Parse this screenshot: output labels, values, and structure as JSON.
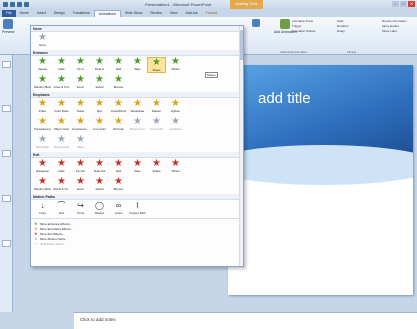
{
  "window": {
    "title": "Presentation1 - Microsoft PowerPoint",
    "context_tab": "Drawing Tools"
  },
  "tabs": [
    "File",
    "Home",
    "Insert",
    "Design",
    "Transitions",
    "Animations",
    "Slide Show",
    "Review",
    "View",
    "Add-Ins",
    "Format"
  ],
  "ribbon": {
    "preview": "Preview",
    "animation_pane": "Animation Pane",
    "trigger": "Trigger",
    "animation_painter": "Animation Painter",
    "add_animation": "Add Animation",
    "advanced_animation": "Advanced Animation",
    "start": "Start:",
    "duration": "Duration:",
    "delay": "Delay:",
    "timing": "Timing",
    "reorder": "Reorder Animation",
    "move_earlier": "Move Earlier",
    "move_later": "Move Later"
  },
  "gallery": {
    "none_header": "None",
    "none_items": [
      {
        "label": "None",
        "color": "s-gray"
      }
    ],
    "entrance_header": "Entrance",
    "entrance_row1": [
      {
        "label": "Appear",
        "color": "s-green"
      },
      {
        "label": "Fade",
        "color": "s-green"
      },
      {
        "label": "Fly In",
        "color": "s-green"
      },
      {
        "label": "Float In",
        "color": "s-green"
      },
      {
        "label": "Split",
        "color": "s-green"
      },
      {
        "label": "Wipe",
        "color": "s-green"
      },
      {
        "label": "Shape",
        "color": "s-green",
        "highlight": true
      },
      {
        "label": "Wheel",
        "color": "s-green"
      }
    ],
    "entrance_row2": [
      {
        "label": "Random Bars",
        "color": "s-green"
      },
      {
        "label": "Grow & Turn",
        "color": "s-green"
      },
      {
        "label": "Zoom",
        "color": "s-green"
      },
      {
        "label": "Swivel",
        "color": "s-green"
      },
      {
        "label": "Bounce",
        "color": "s-green"
      }
    ],
    "emphasis_header": "Emphasis",
    "emphasis_row1": [
      {
        "label": "Pulse",
        "color": "s-yellow"
      },
      {
        "label": "Color Pulse",
        "color": "s-yellow"
      },
      {
        "label": "Teeter",
        "color": "s-yellow"
      },
      {
        "label": "Spin",
        "color": "s-yellow"
      },
      {
        "label": "Grow/Shrink",
        "color": "s-yellow"
      },
      {
        "label": "Desaturate",
        "color": "s-yellow"
      },
      {
        "label": "Darken",
        "color": "s-yellow"
      },
      {
        "label": "Lighten",
        "color": "s-yellow"
      }
    ],
    "emphasis_row2": [
      {
        "label": "Transparency",
        "color": "s-yellow"
      },
      {
        "label": "Object Color",
        "color": "s-yellow"
      },
      {
        "label": "Complemen...",
        "color": "s-yellow"
      },
      {
        "label": "Line Color",
        "color": "s-yellow"
      },
      {
        "label": "Fill Color",
        "color": "s-yellow"
      },
      {
        "label": "Brush Color",
        "color": "s-gray",
        "dim": true
      },
      {
        "label": "Font Color",
        "color": "s-gray",
        "dim": true
      },
      {
        "label": "Underline",
        "color": "s-gray",
        "dim": true
      }
    ],
    "emphasis_row3": [
      {
        "label": "Bold Flash",
        "color": "s-gray",
        "dim": true
      },
      {
        "label": "Bold Reveal",
        "color": "s-gray",
        "dim": true
      },
      {
        "label": "Wave",
        "color": "s-gray",
        "dim": true
      }
    ],
    "exit_header": "Exit",
    "exit_row1": [
      {
        "label": "Disappear",
        "color": "s-red"
      },
      {
        "label": "Fade",
        "color": "s-red"
      },
      {
        "label": "Fly Out",
        "color": "s-red"
      },
      {
        "label": "Float Out",
        "color": "s-red"
      },
      {
        "label": "Split",
        "color": "s-red"
      },
      {
        "label": "Wipe",
        "color": "s-red"
      },
      {
        "label": "Shape",
        "color": "s-red"
      },
      {
        "label": "Wheel",
        "color": "s-red"
      }
    ],
    "exit_row2": [
      {
        "label": "Random Bars",
        "color": "s-red"
      },
      {
        "label": "Shrink & Tu...",
        "color": "s-red"
      },
      {
        "label": "Zoom",
        "color": "s-red"
      },
      {
        "label": "Swivel",
        "color": "s-red"
      },
      {
        "label": "Bounce",
        "color": "s-red"
      }
    ],
    "motion_header": "Motion Paths",
    "motion_row": [
      {
        "label": "Lines",
        "glyph": "↓"
      },
      {
        "label": "Arcs",
        "glyph": "⌒"
      },
      {
        "label": "Turns",
        "glyph": "↪"
      },
      {
        "label": "Shapes",
        "glyph": "◯"
      },
      {
        "label": "Loops",
        "glyph": "∞"
      },
      {
        "label": "Custom Path",
        "glyph": "⌇"
      }
    ],
    "more_entrance": "More Entrance Effects...",
    "more_emphasis": "More Emphasis Effects...",
    "more_exit": "More Exit Effects...",
    "more_motion": "More Motion Paths...",
    "ole_verbs": "OLE Action Verbs...",
    "tooltip": "Shape"
  },
  "slide": {
    "title_placeholder": "add title"
  },
  "notes": {
    "placeholder": "Click to add notes"
  }
}
